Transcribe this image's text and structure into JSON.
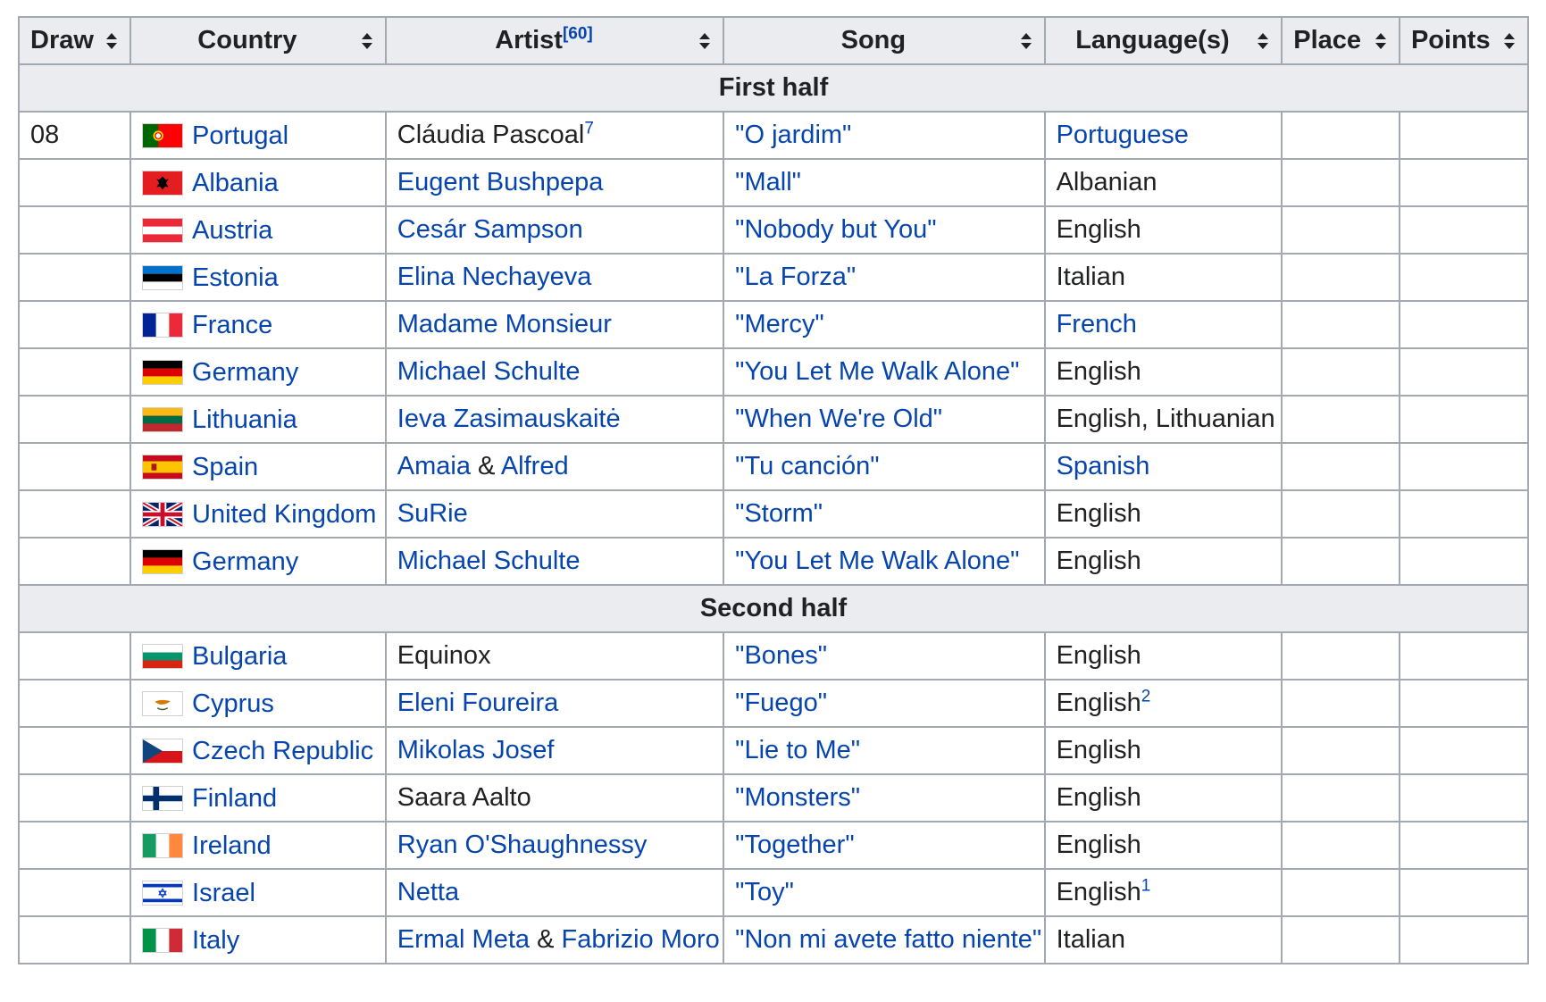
{
  "header": {
    "draw": "Draw",
    "country": "Country",
    "artist": "Artist",
    "artist_ref": "[60]",
    "song": "Song",
    "languages": "Language(s)",
    "place": "Place",
    "points": "Points"
  },
  "sections": {
    "first": "First half",
    "second": "Second half"
  },
  "rows_first": [
    {
      "draw": "08",
      "country": "Portugal",
      "flag": "portugal-flag-icon",
      "artist_parts": [
        {
          "text": "Cláudia Pascoal",
          "link": false
        }
      ],
      "artist_sup": "7",
      "song": "\"O jardim\"",
      "language": "Portuguese",
      "language_link": true,
      "language_sup": ""
    },
    {
      "draw": "",
      "country": "Albania",
      "flag": "albania-flag-icon",
      "artist_parts": [
        {
          "text": "Eugent Bushpepa",
          "link": true
        }
      ],
      "artist_sup": "",
      "song": "\"Mall\"",
      "language": "Albanian",
      "language_link": false,
      "language_sup": ""
    },
    {
      "draw": "",
      "country": "Austria",
      "flag": "austria-flag-icon",
      "artist_parts": [
        {
          "text": "Cesár Sampson",
          "link": true
        }
      ],
      "artist_sup": "",
      "song": "\"Nobody but You\"",
      "language": "English",
      "language_link": false,
      "language_sup": ""
    },
    {
      "draw": "",
      "country": "Estonia",
      "flag": "estonia-flag-icon",
      "artist_parts": [
        {
          "text": "Elina Nechayeva",
          "link": true
        }
      ],
      "artist_sup": "",
      "song": "\"La Forza\"",
      "language": "Italian",
      "language_link": false,
      "language_sup": ""
    },
    {
      "draw": "",
      "country": "France",
      "flag": "france-flag-icon",
      "artist_parts": [
        {
          "text": "Madame Monsieur",
          "link": true
        }
      ],
      "artist_sup": "",
      "song": "\"Mercy\"",
      "language": "French",
      "language_link": true,
      "language_sup": ""
    },
    {
      "draw": "",
      "country": "Germany",
      "flag": "germany-flag-icon",
      "artist_parts": [
        {
          "text": "Michael Schulte",
          "link": true
        }
      ],
      "artist_sup": "",
      "song": "\"You Let Me Walk Alone\"",
      "language": "English",
      "language_link": false,
      "language_sup": ""
    },
    {
      "draw": "",
      "country": "Lithuania",
      "flag": "lithuania-flag-icon",
      "artist_parts": [
        {
          "text": "Ieva Zasimauskaitė",
          "link": true
        }
      ],
      "artist_sup": "",
      "song": "\"When We're Old\"",
      "language": "English, Lithuanian",
      "language_link": false,
      "language_sup": ""
    },
    {
      "draw": "",
      "country": "Spain",
      "flag": "spain-flag-icon",
      "artist_parts": [
        {
          "text": "Amaia",
          "link": true
        },
        {
          "text": " & ",
          "link": false
        },
        {
          "text": "Alfred",
          "link": true
        }
      ],
      "artist_sup": "",
      "song": "\"Tu canción\"",
      "language": "Spanish",
      "language_link": true,
      "language_sup": ""
    },
    {
      "draw": "",
      "country": "United Kingdom",
      "flag": "uk-flag-icon",
      "artist_parts": [
        {
          "text": "SuRie",
          "link": true
        }
      ],
      "artist_sup": "",
      "song": "\"Storm\"",
      "language": "English",
      "language_link": false,
      "language_sup": ""
    },
    {
      "draw": "",
      "country": "Germany",
      "flag": "germany-flag-icon",
      "artist_parts": [
        {
          "text": "Michael Schulte",
          "link": true
        }
      ],
      "artist_sup": "",
      "song": "\"You Let Me Walk Alone\"",
      "language": "English",
      "language_link": false,
      "language_sup": ""
    }
  ],
  "rows_second": [
    {
      "draw": "",
      "country": "Bulgaria",
      "flag": "bulgaria-flag-icon",
      "artist_parts": [
        {
          "text": "Equinox",
          "link": false
        }
      ],
      "artist_sup": "",
      "song": "\"Bones\"",
      "language": "English",
      "language_link": false,
      "language_sup": ""
    },
    {
      "draw": "",
      "country": "Cyprus",
      "flag": "cyprus-flag-icon",
      "artist_parts": [
        {
          "text": "Eleni Foureira",
          "link": true
        }
      ],
      "artist_sup": "",
      "song": "\"Fuego\"",
      "language": "English",
      "language_link": false,
      "language_sup": "2"
    },
    {
      "draw": "",
      "country": "Czech Republic",
      "flag": "czech-flag-icon",
      "artist_parts": [
        {
          "text": "Mikolas Josef",
          "link": true
        }
      ],
      "artist_sup": "",
      "song": "\"Lie to Me\"",
      "language": "English",
      "language_link": false,
      "language_sup": ""
    },
    {
      "draw": "",
      "country": "Finland",
      "flag": "finland-flag-icon",
      "artist_parts": [
        {
          "text": "Saara Aalto",
          "link": false
        }
      ],
      "artist_sup": "",
      "song": "\"Monsters\"",
      "language": "English",
      "language_link": false,
      "language_sup": ""
    },
    {
      "draw": "",
      "country": "Ireland",
      "flag": "ireland-flag-icon",
      "artist_parts": [
        {
          "text": "Ryan O'Shaughnessy",
          "link": true
        }
      ],
      "artist_sup": "",
      "song": "\"Together\"",
      "language": "English",
      "language_link": false,
      "language_sup": ""
    },
    {
      "draw": "",
      "country": "Israel",
      "flag": "israel-flag-icon",
      "artist_parts": [
        {
          "text": "Netta",
          "link": true
        }
      ],
      "artist_sup": "",
      "song": "\"Toy\"",
      "language": "English",
      "language_link": false,
      "language_sup": "1"
    },
    {
      "draw": "",
      "country": "Italy",
      "flag": "italy-flag-icon",
      "artist_parts": [
        {
          "text": "Ermal Meta",
          "link": true
        },
        {
          "text": " & ",
          "link": false
        },
        {
          "text": "Fabrizio Moro",
          "link": true
        }
      ],
      "artist_sup": "",
      "song": "\"Non mi avete fatto niente\"",
      "language": "Italian",
      "language_link": false,
      "language_sup": ""
    }
  ],
  "colors": {
    "link": "#0645ad",
    "header_bg": "#eaecf0",
    "border": "#a2a9b1",
    "text": "#202122"
  }
}
